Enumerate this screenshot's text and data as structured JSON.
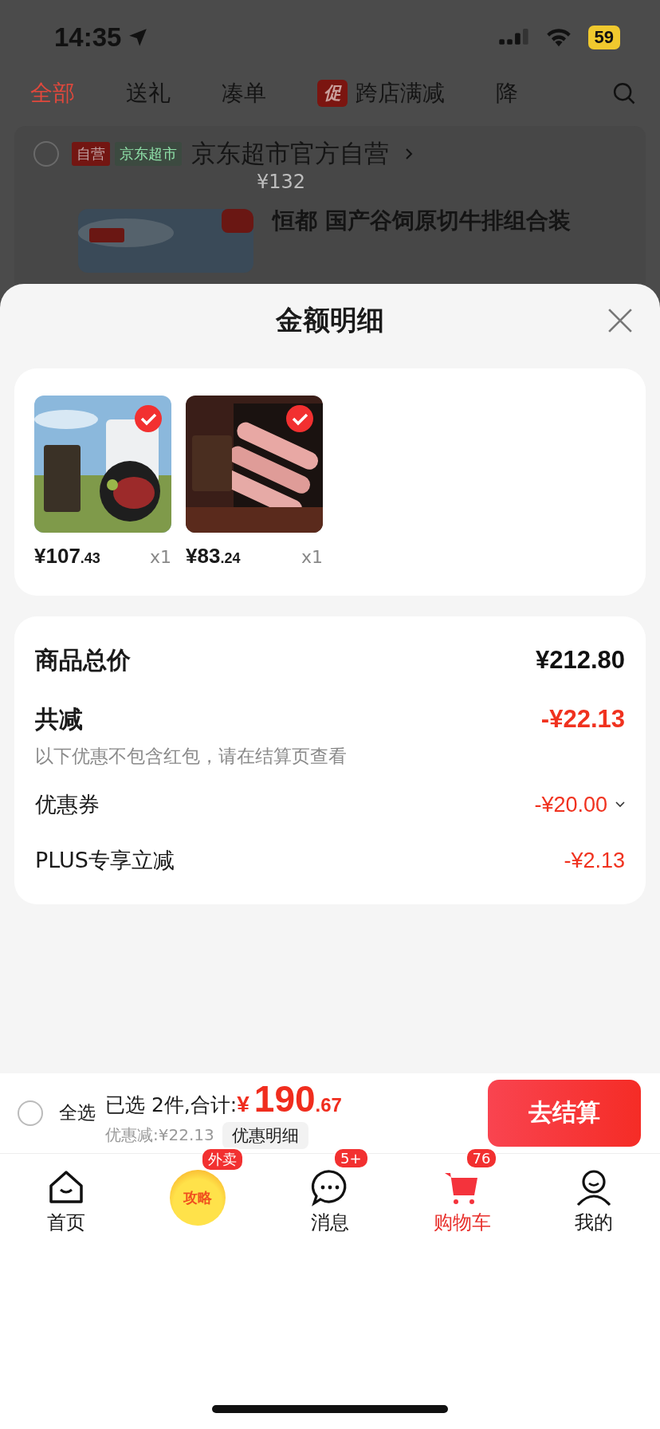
{
  "status_bar": {
    "time": "14:35",
    "battery": "59"
  },
  "tabs": [
    {
      "label": "全部",
      "selected": true
    },
    {
      "label": "送礼",
      "selected": false
    },
    {
      "label": "凑单",
      "selected": false
    },
    {
      "label": "跨店满减",
      "selected": false,
      "tag": "促"
    },
    {
      "label": "降",
      "selected": false
    }
  ],
  "store": {
    "checked": false,
    "tags": [
      {
        "text": "自营",
        "kind": "solid"
      },
      {
        "text": "京东超市",
        "kind": "outline"
      }
    ],
    "name": "京东超市官方自营",
    "price": "¥132",
    "next_product_title": "恒都 国产谷饲原切牛排组合装"
  },
  "sheet": {
    "title": "金额明细",
    "products": [
      {
        "selected": true,
        "price_main": "¥107",
        "price_decimal": ".43",
        "quantity": "x1"
      },
      {
        "selected": true,
        "price_main": "¥83",
        "price_decimal": ".24",
        "quantity": "x1"
      }
    ],
    "summary": [
      {
        "kind": "total",
        "label": "商品总价",
        "amount": "¥212.80"
      },
      {
        "kind": "discount",
        "label": "共减",
        "amount": "-¥22.13",
        "note": "以下优惠不包含红包，请在结算页查看"
      },
      {
        "kind": "item",
        "label": "优惠券",
        "amount": "-¥20.00",
        "expandable": true
      },
      {
        "kind": "item",
        "label": "PLUS专享立减",
        "amount": "-¥2.13",
        "expandable": false
      }
    ]
  },
  "checkout": {
    "select_all": {
      "label": "全选",
      "checked": false
    },
    "selected_text": "已选 2件,合计:",
    "currency": "¥",
    "total_main": "190",
    "total_decimal": ".67",
    "discount_text": "优惠减:¥22.13",
    "details_button": "优惠明细",
    "checkout_button": "去结算"
  },
  "nav": [
    {
      "kind": "home",
      "label": "首页",
      "selected": false
    },
    {
      "kind": "promo",
      "label": "攻略",
      "badge": "外卖",
      "selected": false
    },
    {
      "kind": "message",
      "label": "消息",
      "badge": "5+",
      "selected": false
    },
    {
      "kind": "cart",
      "label": "购物车",
      "badge": "76",
      "selected": true
    },
    {
      "kind": "profile",
      "label": "我的",
      "selected": false
    }
  ]
}
